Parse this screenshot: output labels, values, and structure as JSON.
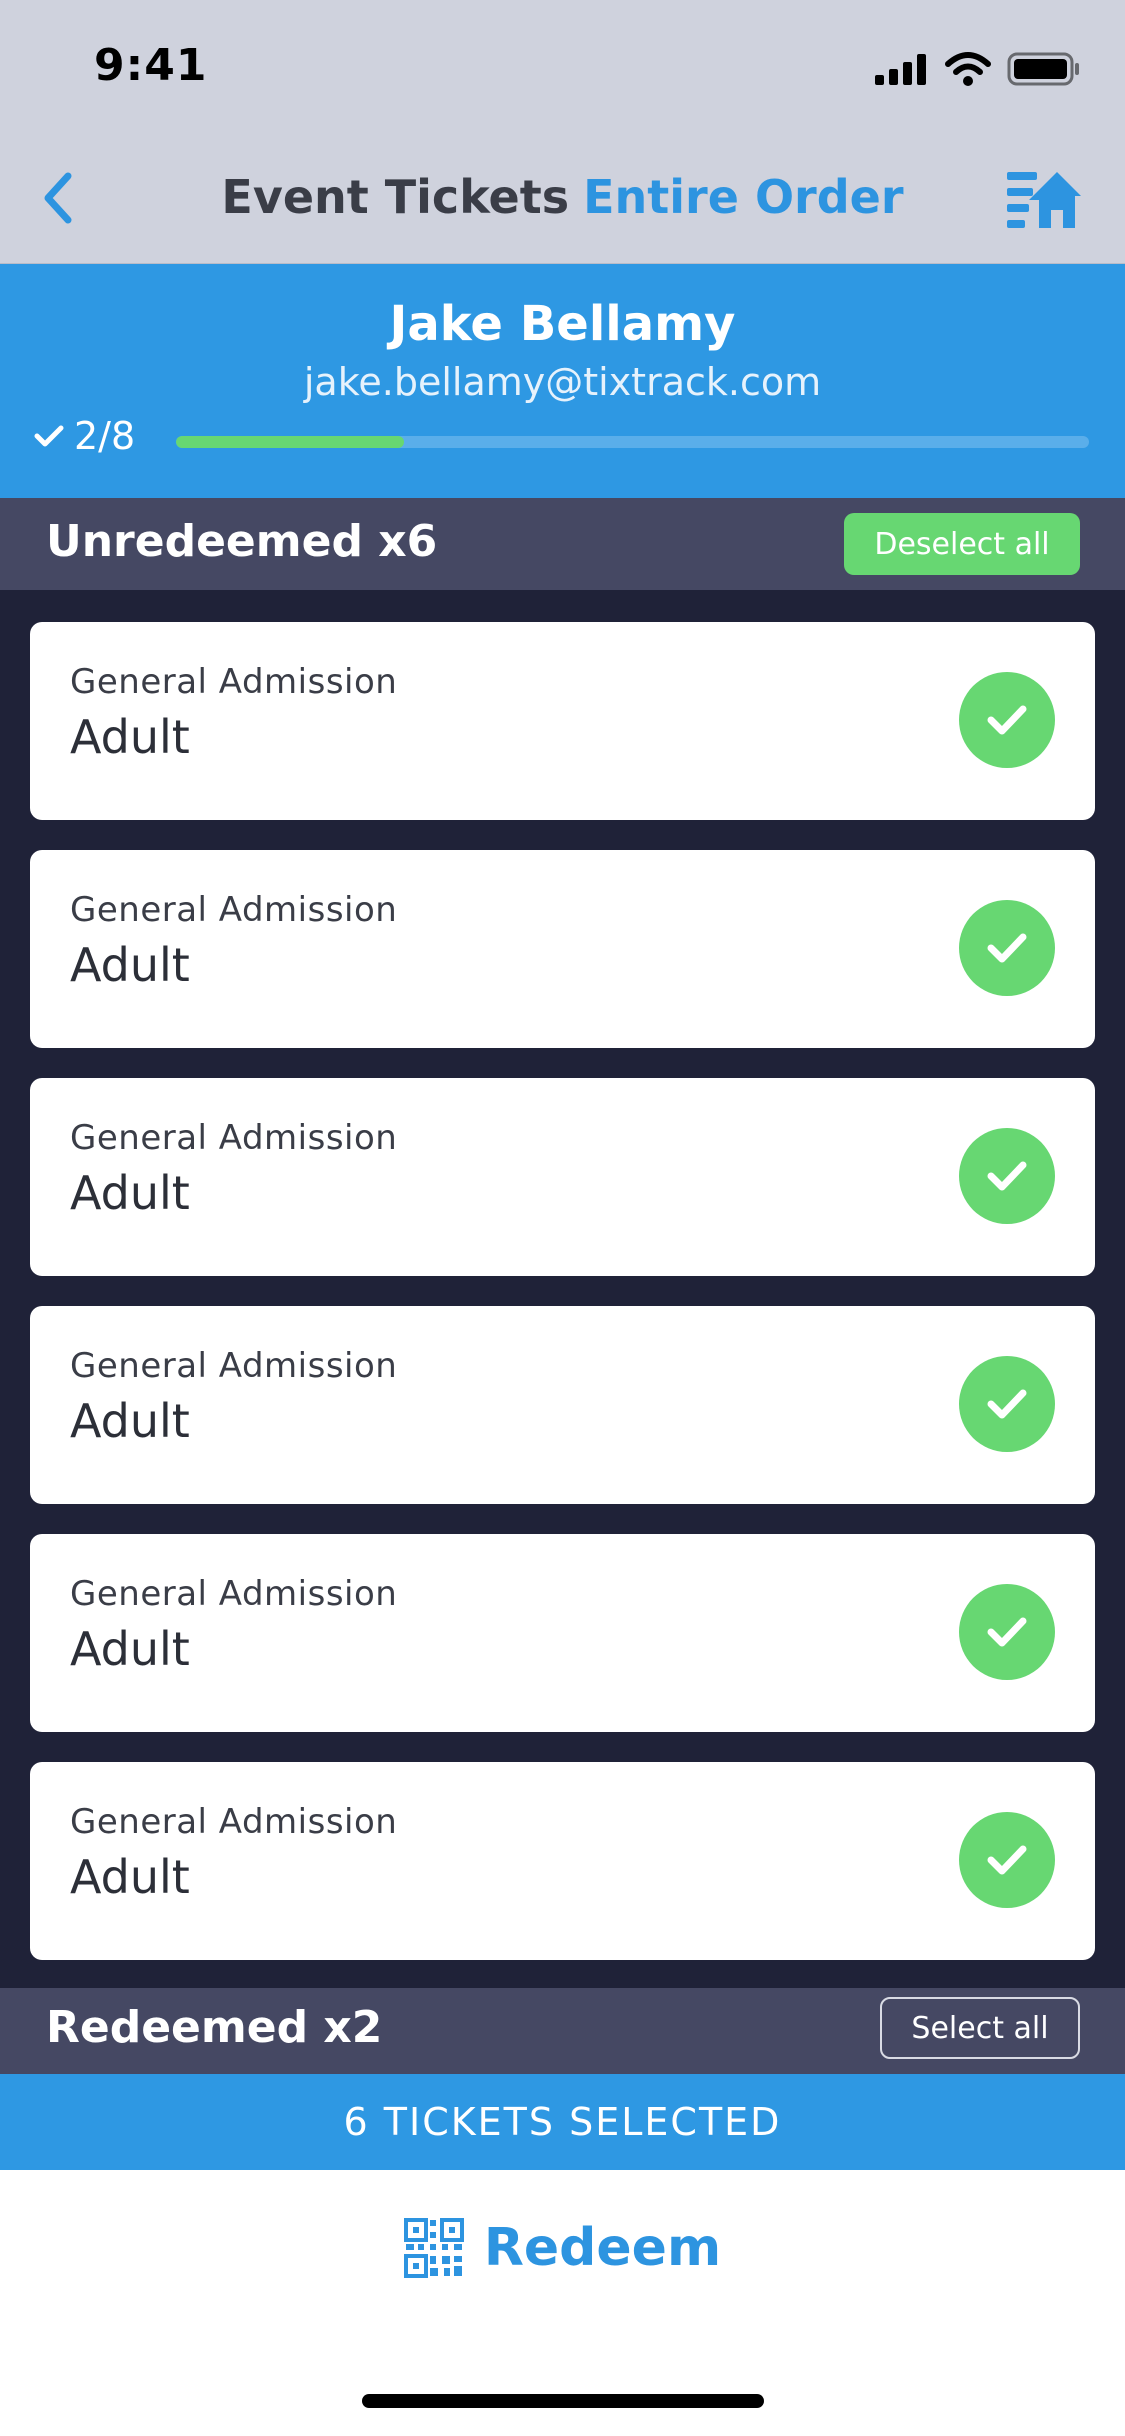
{
  "status_bar": {
    "time": "9:41"
  },
  "nav": {
    "title": "Event Tickets",
    "action_label": "Entire Order"
  },
  "customer": {
    "name": "Jake Bellamy",
    "email": "jake.bellamy@tixtrack.com",
    "progress_label": "2/8",
    "progress_fraction": 0.25
  },
  "unredeemed": {
    "title": "Unredeemed x6",
    "button_label": "Deselect all"
  },
  "tickets": [
    {
      "type": "General Admission",
      "category": "Adult",
      "selected": true
    },
    {
      "type": "General Admission",
      "category": "Adult",
      "selected": true
    },
    {
      "type": "General Admission",
      "category": "Adult",
      "selected": true
    },
    {
      "type": "General Admission",
      "category": "Adult",
      "selected": true
    },
    {
      "type": "General Admission",
      "category": "Adult",
      "selected": true
    },
    {
      "type": "General Admission",
      "category": "Adult",
      "selected": true
    }
  ],
  "redeemed": {
    "title": "Redeemed x2",
    "button_label": "Select all"
  },
  "footer": {
    "selected_label": "6 TICKETS SELECTED",
    "redeem_label": "Redeem"
  },
  "icons": {
    "back": "chevron-left-icon",
    "home": "home-list-icon",
    "check": "checkmark-icon",
    "qr": "qr-code-icon"
  },
  "colors": {
    "accent_blue": "#2e98e3",
    "success_green": "#67d772",
    "section_bg": "#454863",
    "page_bg": "#1f2238"
  }
}
